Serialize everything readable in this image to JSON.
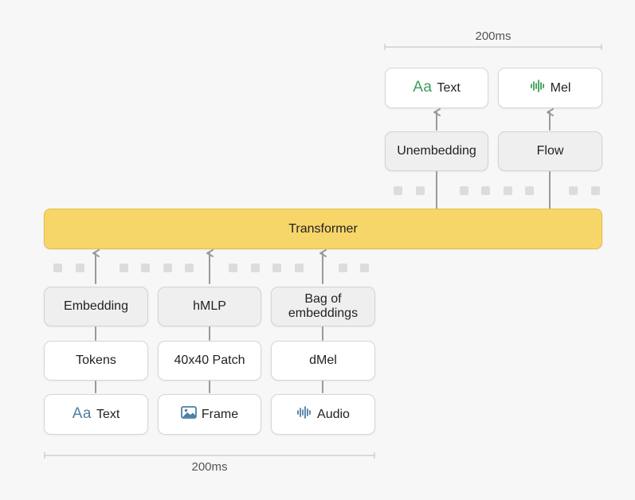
{
  "top_duration": "200ms",
  "bottom_duration": "200ms",
  "transformer": {
    "label": "Transformer"
  },
  "outputs": {
    "text": {
      "icon_text": "Aa",
      "label": "Text",
      "icon": "text-icon",
      "color": "#3f9c5a"
    },
    "mel": {
      "label": "Mel",
      "icon": "waveform-icon",
      "color": "#3f9c5a"
    },
    "unembedding": "Unembedding",
    "flow": "Flow"
  },
  "inputs": {
    "embedding": "Embedding",
    "hmlp": "hMLP",
    "bag_of_embeddings": "Bag of embeddings",
    "tokens": "Tokens",
    "patch": "40x40 Patch",
    "dmel": "dMel",
    "text": {
      "icon_text": "Aa",
      "label": "Text",
      "icon": "text-icon",
      "color": "#4c7fa6"
    },
    "frame": {
      "label": "Frame",
      "icon": "image-icon",
      "color": "#4c7fa6"
    },
    "audio": {
      "label": "Audio",
      "icon": "waveform-icon",
      "color": "#4c7fa6"
    }
  },
  "colors": {
    "transformer_fill": "#f7d669",
    "transformer_border": "#e3bc47",
    "connector": "#9a9a9a",
    "token_square": "#dcdcdc"
  }
}
